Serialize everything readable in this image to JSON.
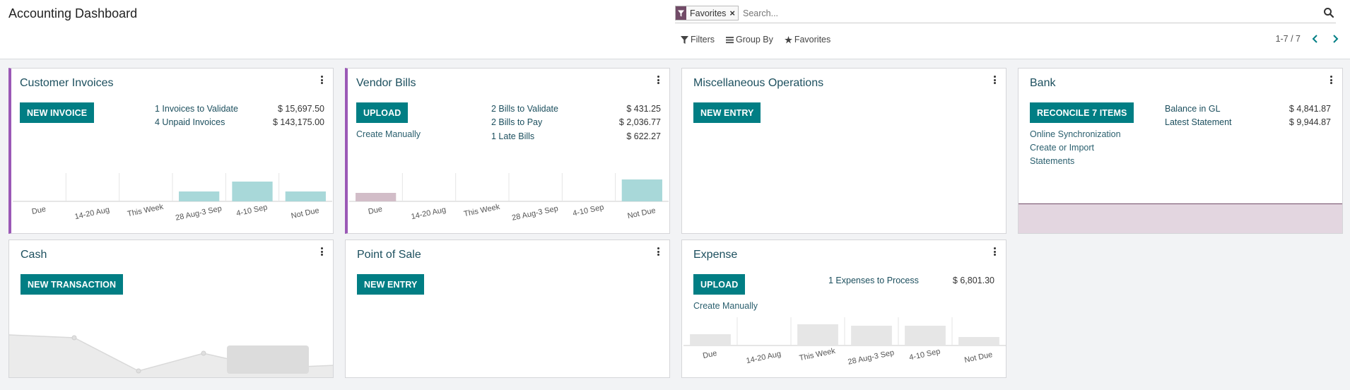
{
  "page": {
    "title": "Accounting Dashboard"
  },
  "search": {
    "facet_label": "Favorites",
    "placeholder": "Search..."
  },
  "filters": {
    "filters_label": "Filters",
    "groupby_label": "Group By",
    "favorites_label": "Favorites"
  },
  "pager": {
    "value": "1-7 / 7"
  },
  "cards": {
    "customer_invoices": {
      "title": "Customer Invoices",
      "button": "NEW INVOICE",
      "stats": [
        {
          "label": "1 Invoices to Validate",
          "amount": "$ 15,697.50"
        },
        {
          "label": "4 Unpaid Invoices",
          "amount": "$ 143,175.00"
        }
      ]
    },
    "vendor_bills": {
      "title": "Vendor Bills",
      "button": "UPLOAD",
      "secondary_link": "Create Manually",
      "stats": [
        {
          "label": "2 Bills to Validate",
          "amount": "$ 431.25"
        },
        {
          "label": "2 Bills to Pay",
          "amount": "$ 2,036.77"
        },
        {
          "label": "1 Late Bills",
          "amount": "$ 622.27"
        }
      ]
    },
    "misc_operations": {
      "title": "Miscellaneous Operations",
      "button": "NEW ENTRY"
    },
    "bank": {
      "title": "Bank",
      "button": "RECONCILE 7 ITEMS",
      "links": [
        "Online Synchronization",
        "Create or Import",
        "Statements"
      ],
      "stats": [
        {
          "label": "Balance in GL",
          "amount": "$ 4,841.87"
        },
        {
          "label": "Latest Statement",
          "amount": "$ 9,944.87"
        }
      ]
    },
    "cash": {
      "title": "Cash",
      "button": "NEW TRANSACTION"
    },
    "point_of_sale": {
      "title": "Point of Sale",
      "button": "NEW ENTRY"
    },
    "expense": {
      "title": "Expense",
      "button": "UPLOAD",
      "secondary_link": "Create Manually",
      "stats": [
        {
          "label": "1 Expenses to Process",
          "amount": "$ 6,801.30"
        }
      ]
    }
  },
  "chart_labels": [
    "Due",
    "14-20 Aug",
    "This Week",
    "28 Aug-3 Sep",
    "4-10 Sep",
    "Not Due"
  ],
  "charts": {
    "customer_invoices": {
      "values": [
        0,
        0,
        0,
        14,
        28,
        14
      ],
      "highlight": [],
      "color": "#a8d8d9"
    },
    "vendor_bills": {
      "values": [
        12,
        0,
        0,
        0,
        0,
        31
      ],
      "highlight": [
        0
      ],
      "color": "#a8d8d9",
      "highlight_color": "#d2bdc8"
    },
    "expense": {
      "values": [
        16,
        0,
        30,
        28,
        28,
        12
      ],
      "highlight": [],
      "color": "#e6e6e6"
    }
  },
  "colors": {
    "brand": "#714b67",
    "primary": "#017e84",
    "accent_border": "#9b59b6",
    "link": "#1c4f5e"
  },
  "icons": {
    "facet": "funnel-icon",
    "search": "magnifier-icon",
    "filters": "funnel-icon",
    "groupby": "list-icon",
    "favorites": "star-icon",
    "pager_prev": "chevron-left-icon",
    "pager_next": "chevron-right-icon",
    "card_menu": "kebab-icon"
  }
}
